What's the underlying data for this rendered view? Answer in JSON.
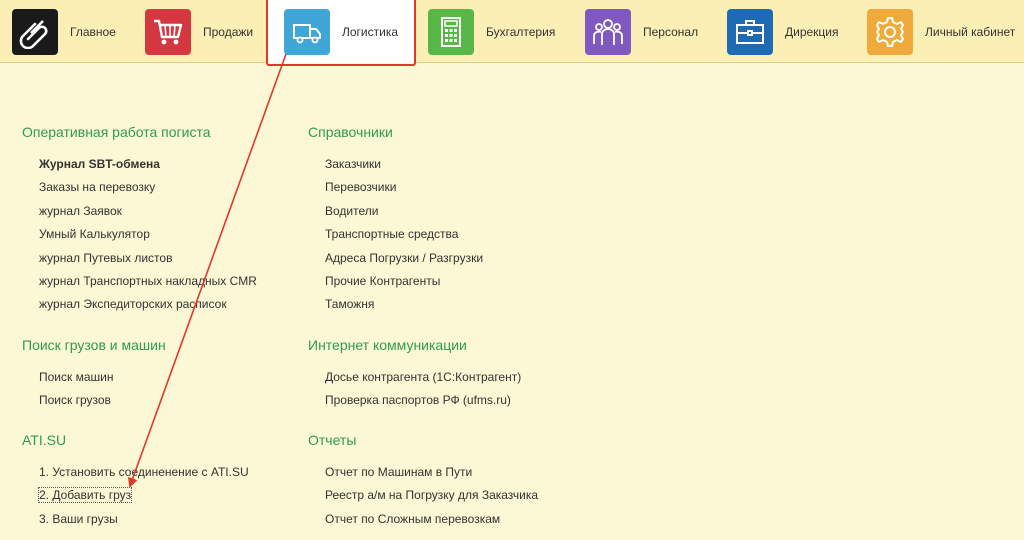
{
  "nav": [
    {
      "label": "Главное",
      "icon": "paperclip-icon",
      "color": "#1a1a1a"
    },
    {
      "label": "Продажи",
      "icon": "shopping-cart-icon",
      "color": "#d4373f"
    },
    {
      "label": "Логистика",
      "icon": "truck-icon",
      "color": "#3fa6d8"
    },
    {
      "label": "Бухгалтерия",
      "icon": "calculator-icon",
      "color": "#58b847"
    },
    {
      "label": "Персонал",
      "icon": "people-icon",
      "color": "#7f59bf"
    },
    {
      "label": "Дирекция",
      "icon": "briefcase-icon",
      "color": "#1e6ab5"
    },
    {
      "label": "Личный кабинет",
      "icon": "gear-icon",
      "color": "#f0a93b"
    }
  ],
  "active_nav": "Логистика",
  "accent_color": "#2e9d4c",
  "highlight_color": "#e0392b",
  "sections": {
    "operative": {
      "title": "Оперативная работа погиста",
      "items": [
        "Журнал SBT-обмена",
        "Заказы на перевозку",
        "журнал Заявок",
        "Умный Калькулятор",
        "журнал Путевых листов",
        "журнал Транспортных накладных CMR",
        "журнал Экспедиторских расписок"
      ]
    },
    "search": {
      "title": "Поиск грузов и машин",
      "items": [
        "Поиск машин",
        "Поиск грузов"
      ]
    },
    "ati": {
      "title": "ATI.SU",
      "items": [
        "1. Установить соединенение с ATI.SU",
        "2. Добавить груз",
        "3. Ваши грузы"
      ]
    },
    "references": {
      "title": "Справочники",
      "items": [
        "Заказчики",
        "Перевозчики",
        "Водители",
        "Транспортные средства",
        "Адреса Погрузки / Разгрузки",
        "Прочие Контрагенты",
        "Таможня"
      ]
    },
    "internet": {
      "title": "Интернет коммуникации",
      "items": [
        "Досье контрагента (1С:Контрагент)",
        "Проверка паспортов РФ (ufms.ru)"
      ]
    },
    "reports": {
      "title": "Отчеты",
      "items": [
        "Отчет по Машинам в Пути",
        "Реестр а/м на Погрузку для Заказчика",
        "Отчет по Сложным перевозкам"
      ]
    }
  }
}
